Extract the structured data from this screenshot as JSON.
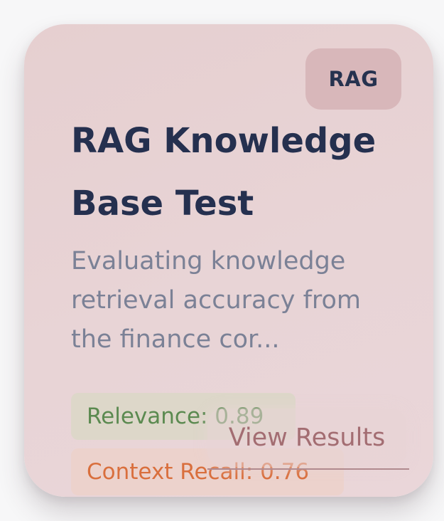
{
  "card": {
    "badge": "RAG",
    "title": "RAG Knowledge Base Test",
    "description": "Evaluating knowledge retrieval accuracy from the finance cor...",
    "metrics": [
      {
        "label": "Relevance: 0.89",
        "color": "#5b8a50"
      },
      {
        "label": "Context Recall: 0.76",
        "color": "#d96f3d"
      }
    ],
    "action_label": "View Results"
  },
  "colors": {
    "card_bg": "#e6cfd0",
    "badge_bg": "#d8b7ba",
    "title": "#25304f",
    "description": "#7b8196",
    "action": "#a36d72"
  }
}
